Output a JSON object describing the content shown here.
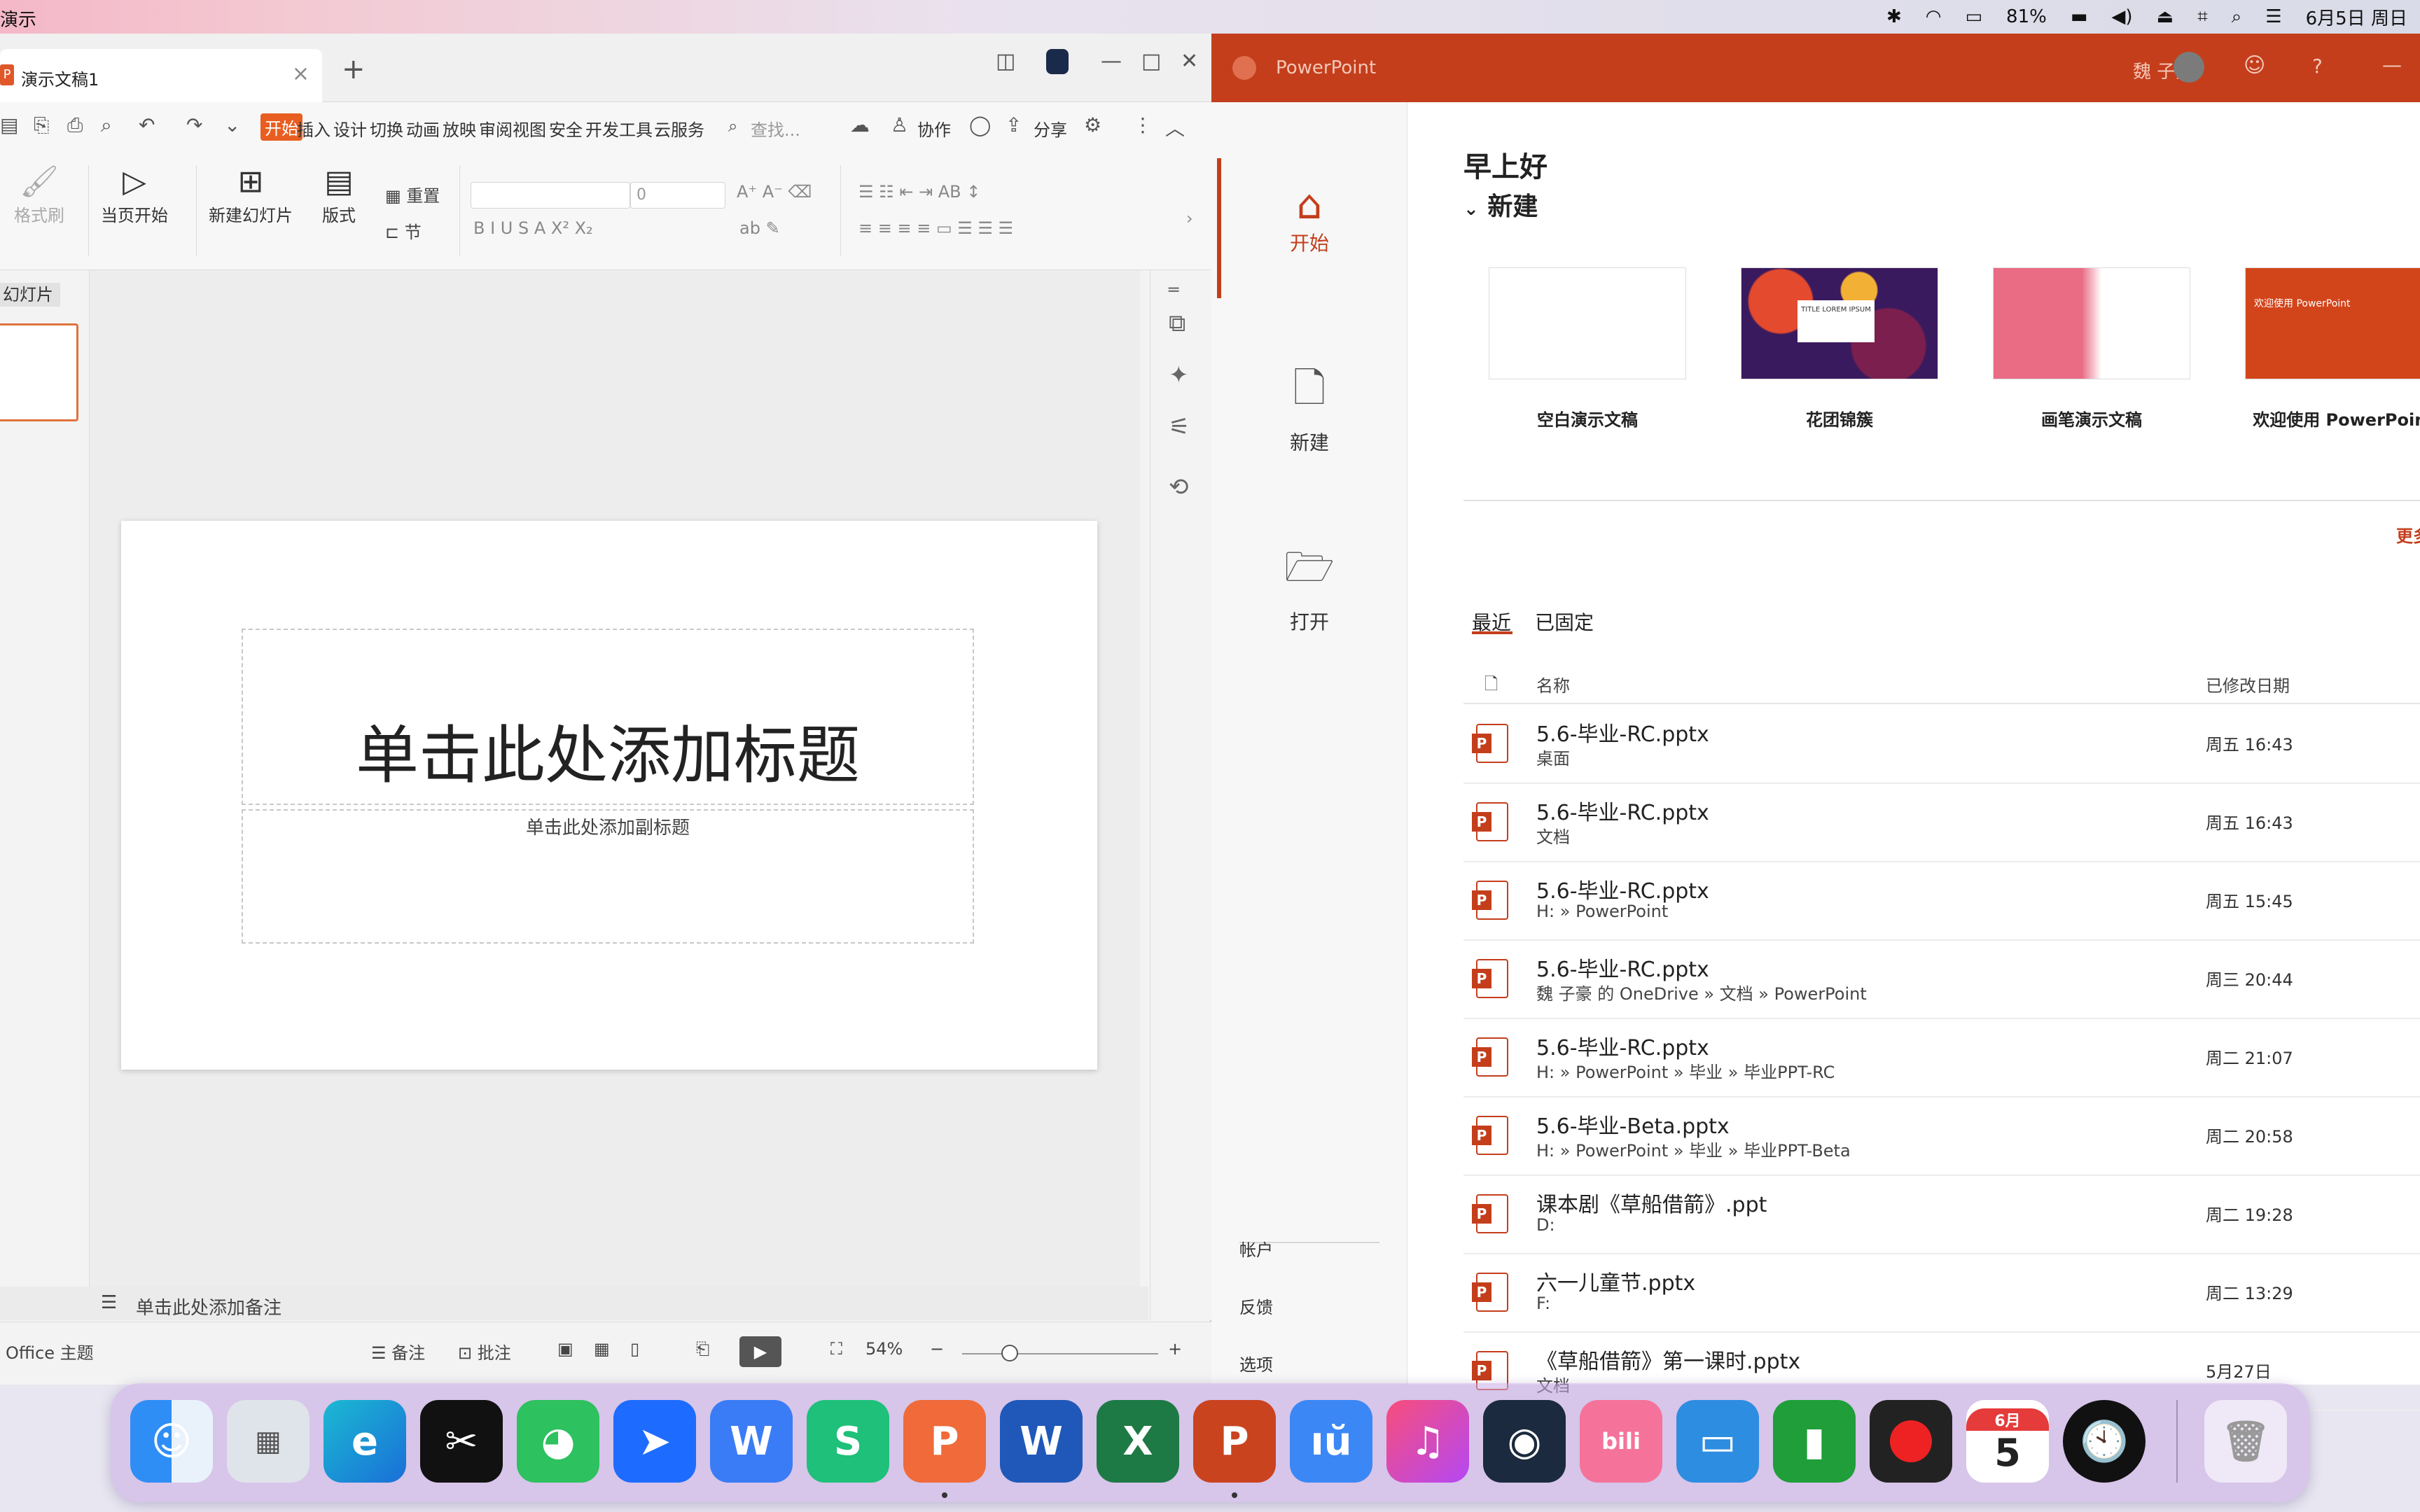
{
  "menubar": {
    "app_title": "演示",
    "battery": "81%",
    "datetime": "6月5日 周日"
  },
  "wps": {
    "tab_badge": "P",
    "tab_title": "演示文稿1",
    "menu": [
      "开始",
      "插入",
      "设计",
      "切换",
      "动画",
      "放映",
      "审阅",
      "视图",
      "安全",
      "开发工具",
      "云服务"
    ],
    "search_placeholder": "查找...",
    "collab": "协作",
    "share": "分享",
    "ribbon": {
      "format_painter": "格式刷",
      "from_current": "当页开始",
      "new_slide": "新建幻灯片",
      "layout": "版式",
      "reset": "重置",
      "section": "节",
      "font_size": "0"
    },
    "thumb_pane_label": "幻灯片",
    "slide": {
      "title_placeholder": "单击此处添加标题",
      "subtitle_placeholder": "单击此处添加副标题"
    },
    "notes_placeholder": "单击此处添加备注",
    "status": {
      "theme": "Office 主题",
      "notes": "备注",
      "comments": "批注",
      "zoom": "54%"
    }
  },
  "ppt": {
    "title": "PowerPoint",
    "user": "魏 子豪",
    "greeting": "早上好",
    "new_section": "新建",
    "nav": {
      "home": "开始",
      "new": "新建",
      "open": "打开",
      "account": "帐户",
      "feedback": "反馈",
      "options": "选项"
    },
    "templates": [
      {
        "name": "空白演示文稿"
      },
      {
        "name": "花团锦簇",
        "thumb_text": "TITLE LOREM IPSUM"
      },
      {
        "name": "画笔演示文稿"
      },
      {
        "name": "欢迎使用 PowerPoint",
        "thumb_text": "欢迎使用 PowerPoint"
      }
    ],
    "more_themes": "更多主",
    "tabs": {
      "recent": "最近",
      "pinned": "已固定"
    },
    "columns": {
      "name": "名称",
      "modified": "已修改日期"
    },
    "files": [
      {
        "name": "5.6-毕业-RC.pptx",
        "path": "桌面",
        "date": "周五 16:43"
      },
      {
        "name": "5.6-毕业-RC.pptx",
        "path": "文档",
        "date": "周五 16:43"
      },
      {
        "name": "5.6-毕业-RC.pptx",
        "path": "H: » PowerPoint",
        "date": "周五 15:45"
      },
      {
        "name": "5.6-毕业-RC.pptx",
        "path": "魏 子豪 的 OneDrive » 文档 » PowerPoint",
        "date": "周三 20:44"
      },
      {
        "name": "5.6-毕业-RC.pptx",
        "path": "H: » PowerPoint » 毕业 » 毕业PPT-RC",
        "date": "周二 21:07"
      },
      {
        "name": "5.6-毕业-Beta.pptx",
        "path": "H: » PowerPoint » 毕业 » 毕业PPT-Beta",
        "date": "周二 20:58"
      },
      {
        "name": "课本剧《草船借箭》.ppt",
        "path": "D:",
        "date": "周二 19:28"
      },
      {
        "name": "六一儿童节.pptx",
        "path": "F:",
        "date": "周二 13:29"
      },
      {
        "name": "《草船借箭》第一课时.pptx",
        "path": "文档",
        "date": "5月27日"
      }
    ]
  },
  "dock": {
    "calendar_month": "6月",
    "calendar_day": "5",
    "apps": [
      "finder-icon",
      "launchpad-icon",
      "edge-icon",
      "capcut-icon",
      "wechat-icon",
      "feishu-icon",
      "wps-writer-icon",
      "wps-sheets-icon",
      "wps-presentation-icon",
      "word-icon",
      "excel-icon",
      "powerpoint-icon",
      "baidu-netdisk-icon",
      "music-icon",
      "steam-icon",
      "bilibili-icon",
      "remote-desktop-icon",
      "network-drive-icon",
      "screen-record-icon",
      "calendar-icon",
      "clock-icon"
    ]
  }
}
